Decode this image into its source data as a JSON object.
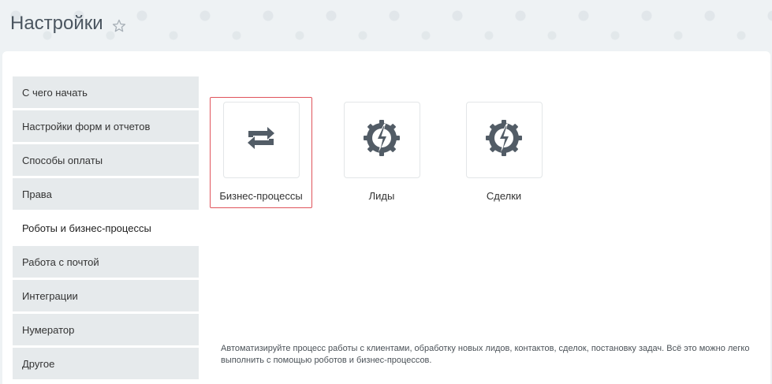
{
  "header": {
    "title": "Настройки"
  },
  "menu": {
    "items": [
      {
        "label": "С чего начать"
      },
      {
        "label": "Настройки форм и отчетов"
      },
      {
        "label": "Способы оплаты"
      },
      {
        "label": "Права"
      },
      {
        "label": "Роботы и бизнес-процессы"
      },
      {
        "label": "Работа с почтой"
      },
      {
        "label": "Интеграции"
      },
      {
        "label": "Нумератор"
      },
      {
        "label": "Другое"
      }
    ],
    "active_index": 4
  },
  "tiles": [
    {
      "label": "Бизнес-процессы",
      "icon": "refresh-arrows-icon",
      "selected": true
    },
    {
      "label": "Лиды",
      "icon": "gear-lightning-icon",
      "selected": false
    },
    {
      "label": "Сделки",
      "icon": "gear-lightning-icon",
      "selected": false
    }
  ],
  "footer": {
    "text": "Автоматизируйте процесс работы с клиентами, обработку новых лидов, контактов, сделок, постановку задач. Всё это можно легко выполнить с помощью роботов и бизнес-процессов."
  },
  "colors": {
    "selection_border": "#e0535b",
    "icon": "#525c66",
    "menu_bg": "#e6eaec"
  }
}
